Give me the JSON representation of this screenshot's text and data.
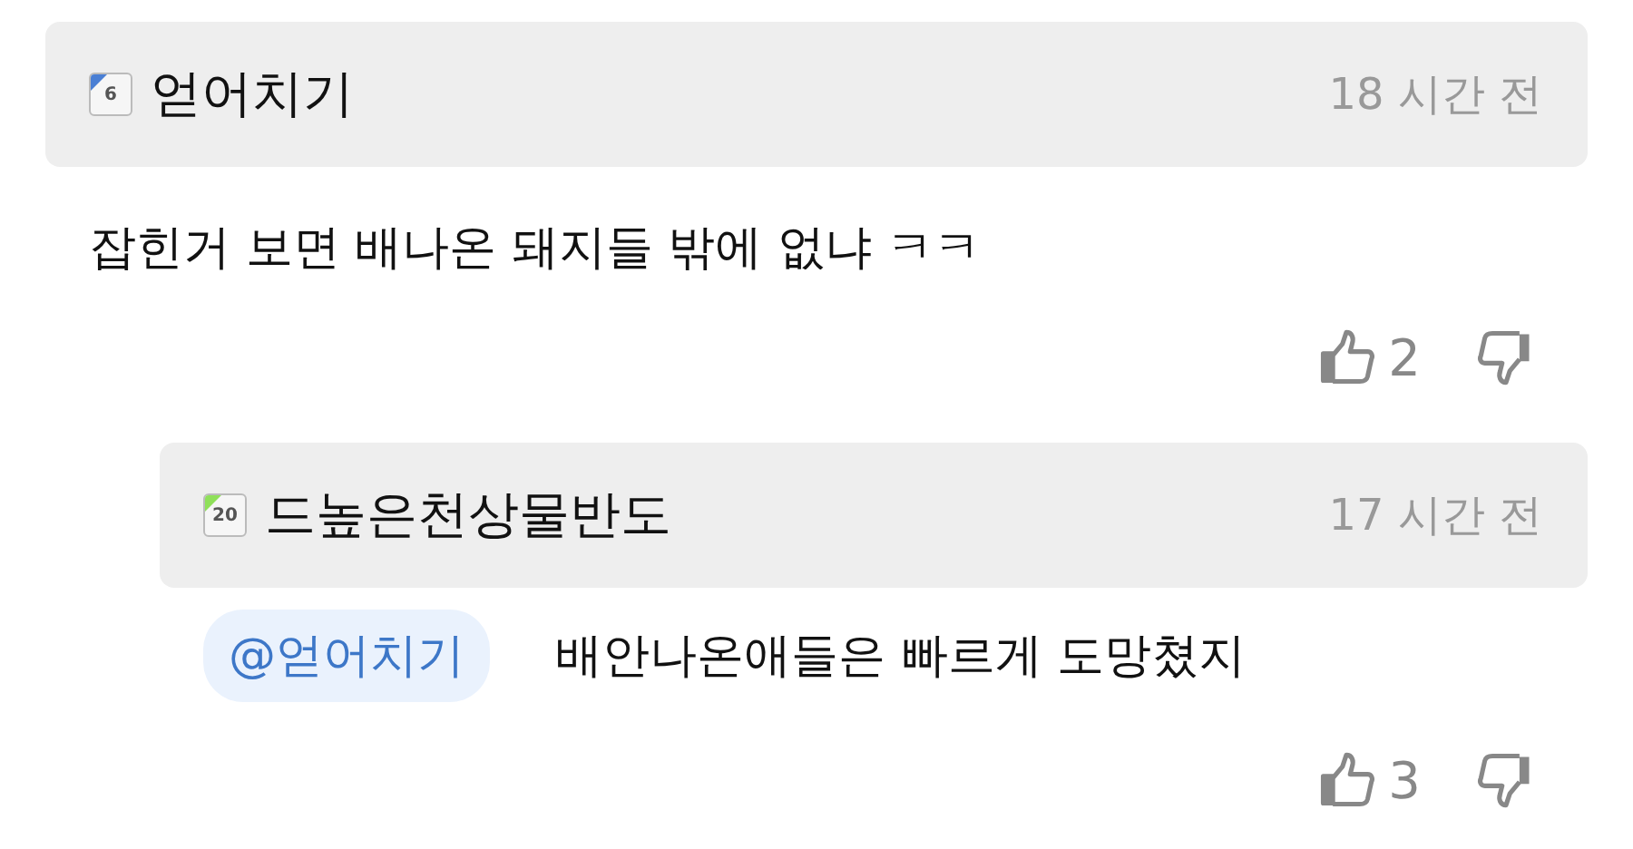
{
  "comments": [
    {
      "level": "6",
      "color": "#4a7fd4",
      "author": "얻어치기",
      "time": "18 시간 전",
      "text": "잡힌거 보면 배나온 돼지들 밖에 없냐 ㅋㅋ",
      "likes": "2",
      "reply": false
    },
    {
      "level": "20",
      "color": "#8fe05a",
      "author": "드높은천상물반도",
      "time": "17 시간 전",
      "mention": "@얻어치기",
      "text": "배안나온애들은 빠르게 도망쳤지",
      "likes": "3",
      "reply": true
    }
  ]
}
